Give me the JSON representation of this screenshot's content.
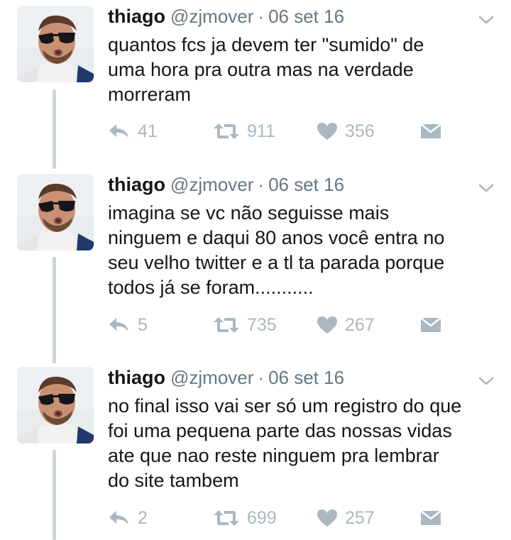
{
  "colors": {
    "name": "#14171a",
    "meta": "#657786",
    "action": "#aab8c2",
    "thread_line": "#ccd6dd"
  },
  "icons": {
    "reply": "reply-icon",
    "retweet": "retweet-icon",
    "like": "heart-icon",
    "dm": "envelope-icon",
    "menu": "chevron-down-icon"
  },
  "tweets": [
    {
      "name": "thiago",
      "handle": "@zjmover",
      "sep": "·",
      "date": "06 set 16",
      "lines": [
        "quantos fcs ja devem ter \"sumido\" de",
        "uma hora pra outra mas na verdade",
        "morreram"
      ],
      "replies": "41",
      "retweets": "911",
      "likes": "356"
    },
    {
      "name": "thiago",
      "handle": "@zjmover",
      "sep": "·",
      "date": "06 set 16",
      "lines": [
        "imagina se vc não seguisse mais",
        "ninguem e daqui 80 anos você entra no",
        "seu velho twitter e a tl ta parada porque",
        "todos já se foram..........."
      ],
      "replies": "5",
      "retweets": "735",
      "likes": "267"
    },
    {
      "name": "thiago",
      "handle": "@zjmover",
      "sep": "·",
      "date": "06 set 16",
      "lines": [
        "no final isso vai ser só um registro do que",
        "foi uma pequena parte das nossas vidas",
        "ate que nao reste ninguem pra lembrar",
        "do site tambem"
      ],
      "replies": "2",
      "retweets": "699",
      "likes": "257"
    }
  ]
}
